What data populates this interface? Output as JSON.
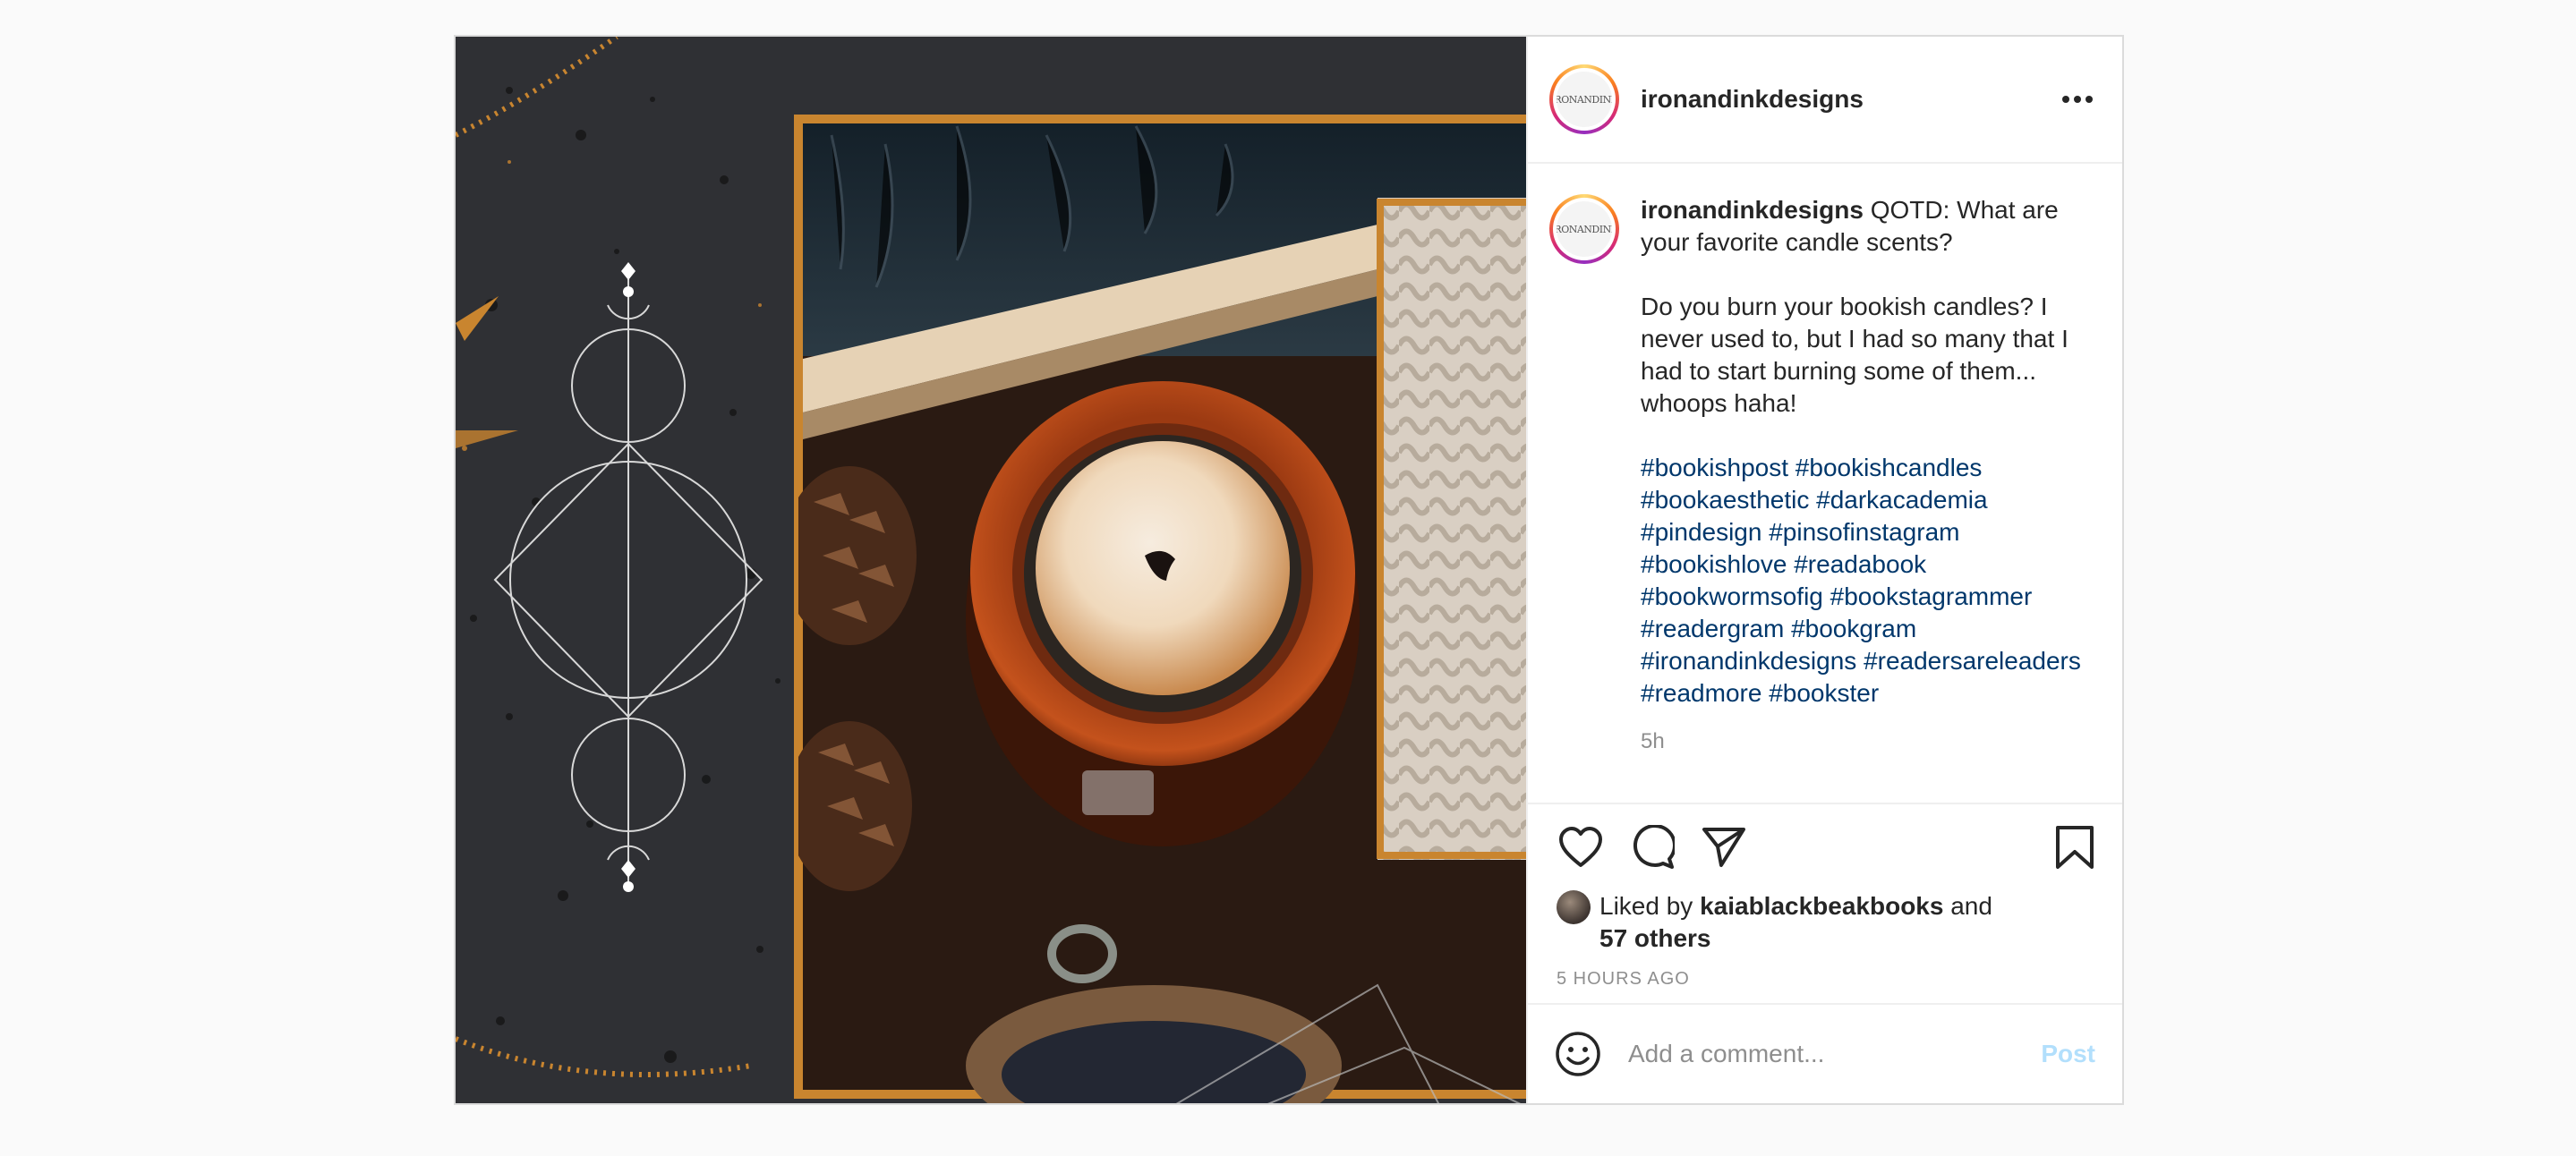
{
  "post": {
    "username": "ironandinkdesigns",
    "avatar_text": "IRONANDINK",
    "more_icon": "more-horizontal-icon",
    "caption": {
      "username": "ironandinkdesigns",
      "lead": " QOTD: What are your favorite candle scents?",
      "body": "Do you burn your bookish candles? I never used to, but I had so many that I had to start burning some of them... whoops haha!",
      "hashtags": [
        "#bookishpost",
        "#bookishcandles",
        "#bookaesthetic",
        "#darkacademia",
        "#pindesign",
        "#pinsofinstagram",
        "#bookishlove",
        "#readabook",
        "#bookwormsofig",
        "#bookstagrammer",
        "#readergram",
        "#bookgram",
        "#ironandinkdesigns",
        "#readersareleaders",
        "#readmore",
        "#bookster"
      ],
      "time_ago": "5h"
    },
    "actions": {
      "like_icon": "heart-icon",
      "comment_icon": "comment-icon",
      "share_icon": "paper-plane-icon",
      "save_icon": "bookmark-icon"
    },
    "likes": {
      "prefix": "Liked by ",
      "user": "kaiablackbeakbooks",
      "middle": " and",
      "others": "57 others"
    },
    "timestamp": "5 HOURS AGO",
    "comment": {
      "placeholder": "Add a comment...",
      "post_label": "Post",
      "emoji_icon": "smiley-icon"
    }
  },
  "colors": {
    "hashtag": "#00376b",
    "post_button_disabled": "#b2dffc",
    "meta_gray": "#8e8e8e",
    "frame_gold": "#c9852f"
  }
}
